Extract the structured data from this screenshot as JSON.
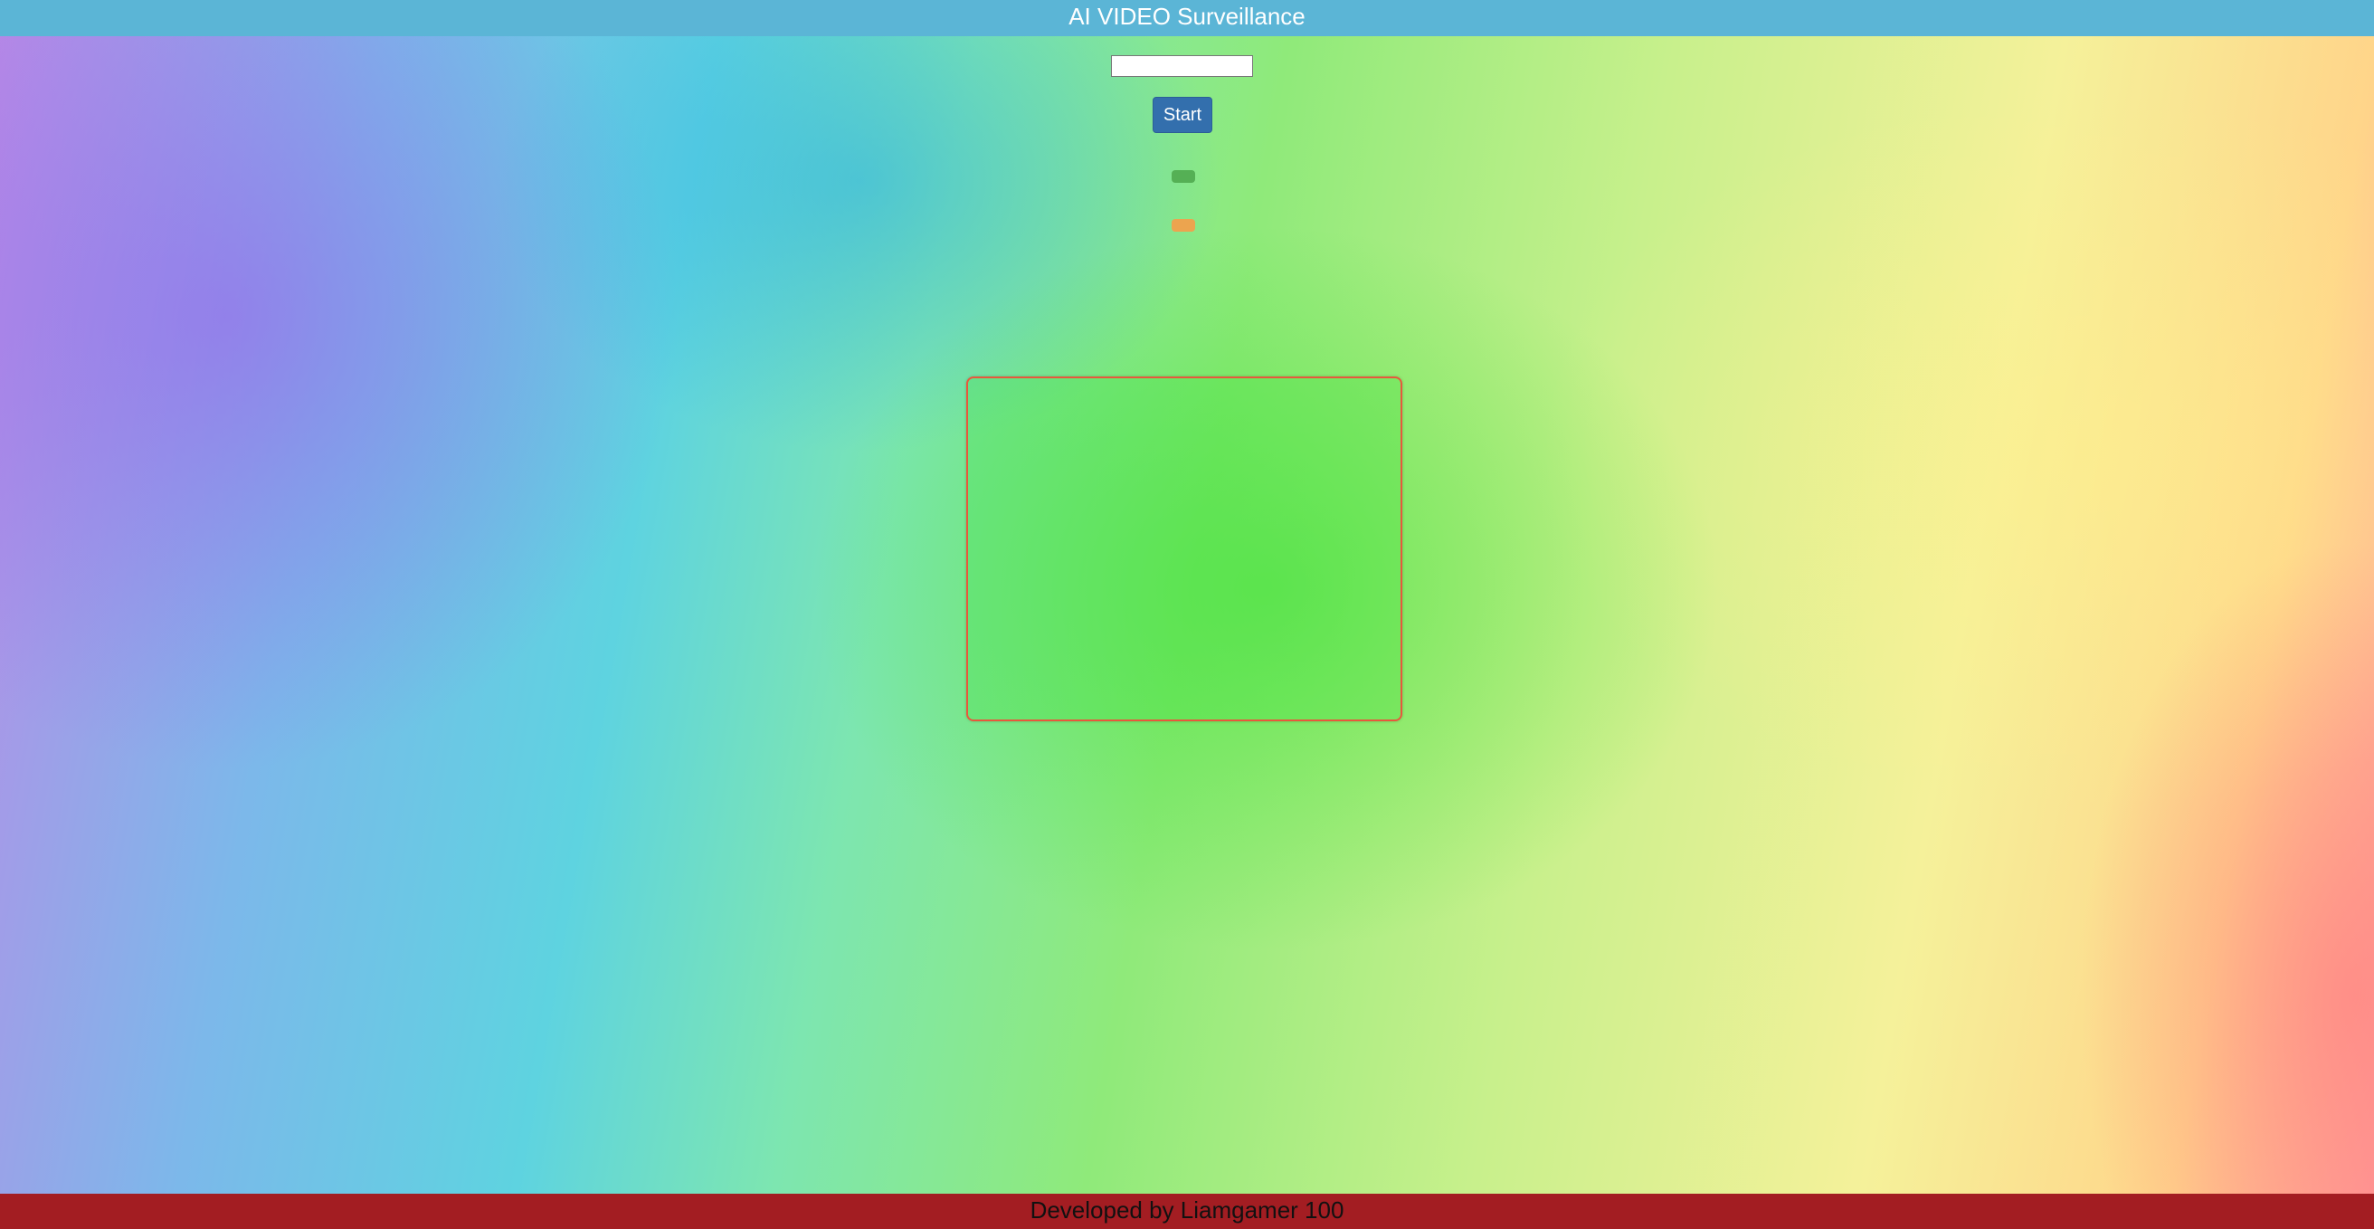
{
  "header": {
    "title": "AI VIDEO Surveillance"
  },
  "controls": {
    "input_value": "",
    "start_label": "Start"
  },
  "indicators": {
    "green_color": "#55b055",
    "orange_color": "#eca44f"
  },
  "footer": {
    "text": "Developed by Liamgamer 100"
  }
}
